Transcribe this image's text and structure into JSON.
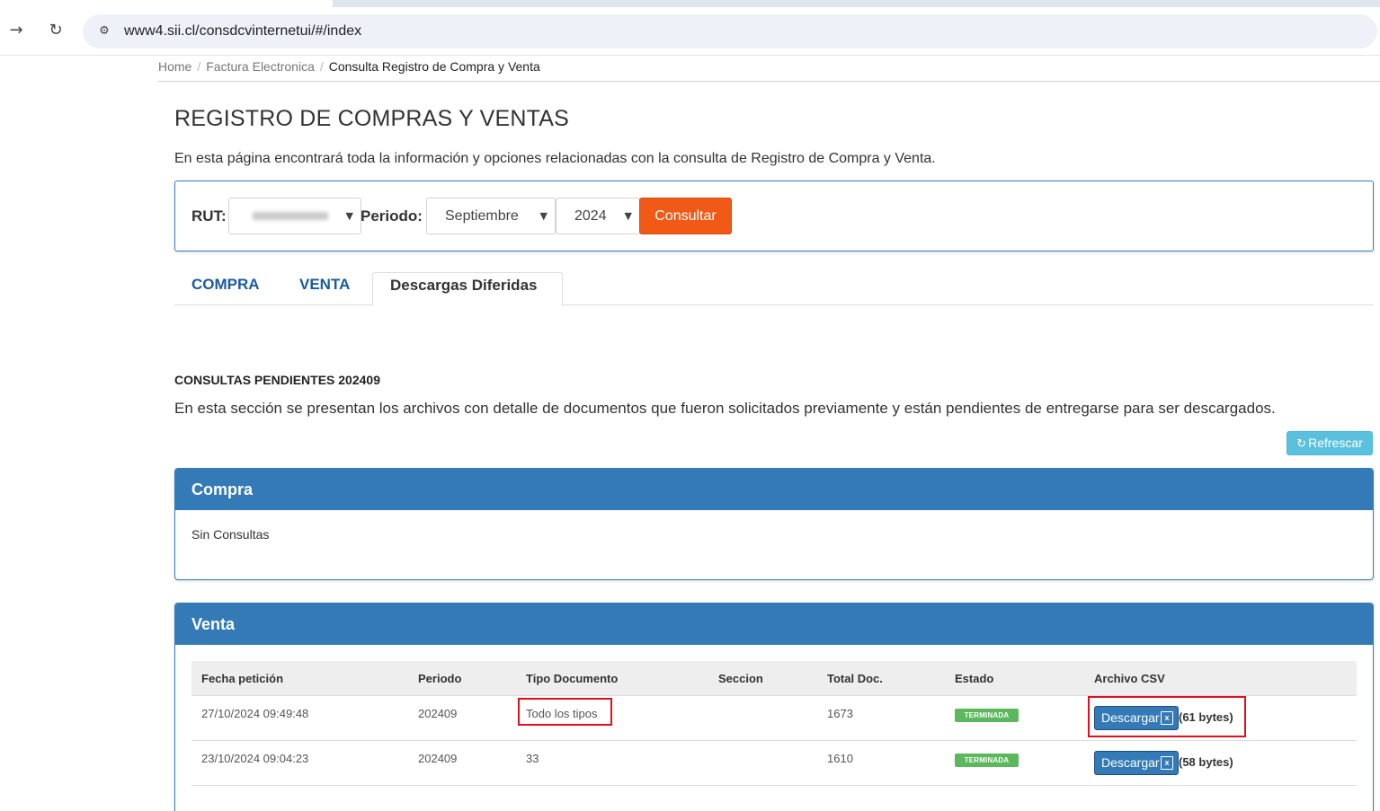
{
  "browser": {
    "url": "www4.sii.cl/consdcvinternetui/#/index"
  },
  "breadcrumb": [
    "Home",
    "Factura Electronica",
    "Consulta Registro de Compra y Venta"
  ],
  "page": {
    "title": "REGISTRO DE COMPRAS Y VENTAS",
    "description": "En esta página encontrará toda la información y opciones relacionadas con la consulta de Registro de Compra y Venta."
  },
  "filter": {
    "rut_label": "RUT:",
    "periodo_label": "Periodo:",
    "month": "Septiembre",
    "year": "2024",
    "consultar_label": "Consultar"
  },
  "tabs": [
    {
      "label": "COMPRA",
      "active": false
    },
    {
      "label": "VENTA",
      "active": false
    },
    {
      "label": "Descargas Diferidas",
      "active": true
    }
  ],
  "pending": {
    "title": "CONSULTAS PENDIENTES 202409",
    "description": "En esta sección se presentan los archivos con detalle de documentos que fueron solicitados previamente y están pendientes de entregarse para ser descargados.",
    "refresh_label": "Refrescar"
  },
  "compra_panel": {
    "title": "Compra",
    "empty_text": "Sin Consultas"
  },
  "venta_panel": {
    "title": "Venta",
    "columns": [
      "Fecha petición",
      "Periodo",
      "Tipo Documento",
      "Seccion",
      "Total Doc.",
      "Estado",
      "Archivo CSV"
    ],
    "rows": [
      {
        "fecha": "27/10/2024 09:49:48",
        "periodo": "202409",
        "tipo": "Todo los tipos",
        "seccion": "",
        "total": "1673",
        "estado": "TERMINADA",
        "download_label": "Descargar",
        "size": "(61 bytes)"
      },
      {
        "fecha": "23/10/2024 09:04:23",
        "periodo": "202409",
        "tipo": "33",
        "seccion": "",
        "total": "1610",
        "estado": "TERMINADA",
        "download_label": "Descargar",
        "size": "(58 bytes)"
      }
    ]
  },
  "colors": {
    "primary": "#337ab7",
    "consultar": "#f05a16",
    "refresh": "#5bc0de",
    "success": "#5cb85c",
    "highlight": "#e0101f"
  }
}
